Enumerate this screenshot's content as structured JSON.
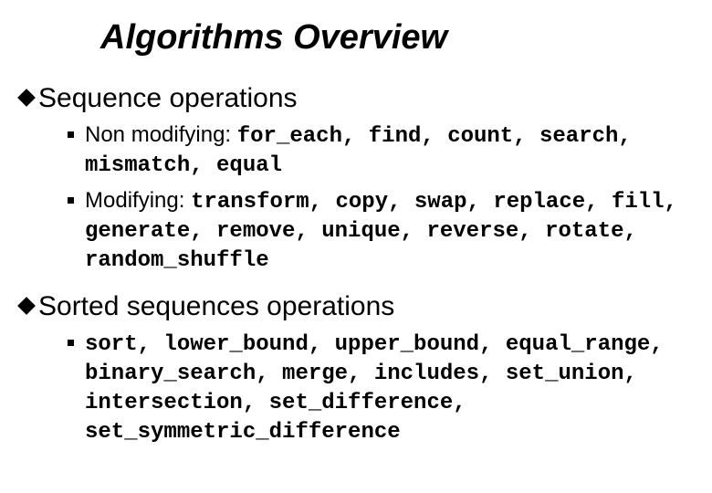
{
  "title": "Algorithms Overview",
  "sections": [
    {
      "heading": "Sequence operations",
      "items": [
        {
          "label": "Non modifying: ",
          "code": "for_each, find, count, search, mismatch, equal"
        },
        {
          "label": "Modifying: ",
          "code": "transform, copy, swap, replace, fill, generate, remove, unique, reverse, rotate, random_shuffle"
        }
      ]
    },
    {
      "heading": "Sorted sequences operations",
      "items": [
        {
          "label": "",
          "code": "sort, lower_bound, upper_bound, equal_range, binary_search, merge, includes, set_union, intersection, set_difference, set_symmetric_difference"
        }
      ]
    }
  ]
}
